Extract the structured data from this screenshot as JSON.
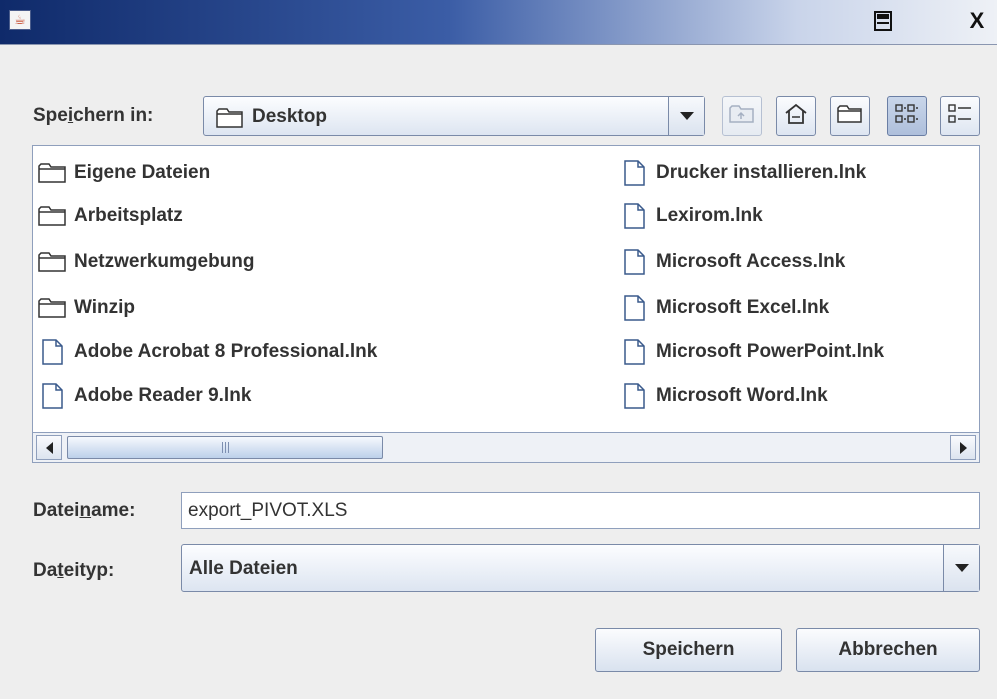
{
  "window": {
    "title": "",
    "title_icon": "java-cup-icon",
    "controls": [
      "restore-icon",
      "close-icon"
    ],
    "close_glyph": "X"
  },
  "save_in": {
    "label_before": "Spe",
    "label_mnemonic": "i",
    "label_after": "chern in:",
    "value": "Desktop",
    "toolbar": [
      "up-one-level-icon",
      "home-icon",
      "new-folder-icon",
      "list-view-icon",
      "details-view-icon"
    ]
  },
  "files": {
    "left": [
      {
        "name": "Eigene Dateien",
        "type": "folder"
      },
      {
        "name": "Arbeitsplatz",
        "type": "folder"
      },
      {
        "name": "Netzwerkumgebung",
        "type": "folder"
      },
      {
        "name": "Winzip",
        "type": "folder"
      },
      {
        "name": "Adobe Acrobat 8 Professional.lnk",
        "type": "file"
      },
      {
        "name": "Adobe Reader 9.lnk",
        "type": "file"
      }
    ],
    "right": [
      {
        "name": "Drucker installieren.lnk",
        "type": "file"
      },
      {
        "name": "Lexirom.lnk",
        "type": "file"
      },
      {
        "name": "Microsoft Access.lnk",
        "type": "file"
      },
      {
        "name": "Microsoft Excel.lnk",
        "type": "file"
      },
      {
        "name": "Microsoft PowerPoint.lnk",
        "type": "file"
      },
      {
        "name": "Microsoft Word.lnk",
        "type": "file"
      }
    ]
  },
  "filename": {
    "label_before": "Datei",
    "label_mnemonic": "n",
    "label_after": "ame:",
    "value": "export_PIVOT.XLS"
  },
  "filetype": {
    "label_before": "Da",
    "label_mnemonic": "t",
    "label_after": "eityp:",
    "value": "Alle Dateien"
  },
  "buttons": {
    "save": "Speichern",
    "cancel": "Abbrechen"
  },
  "colors": {
    "title_gradient_start": "#0f2a6a",
    "button_gradient_bottom": "#d9e2ef",
    "list_background": "#ffffff"
  }
}
